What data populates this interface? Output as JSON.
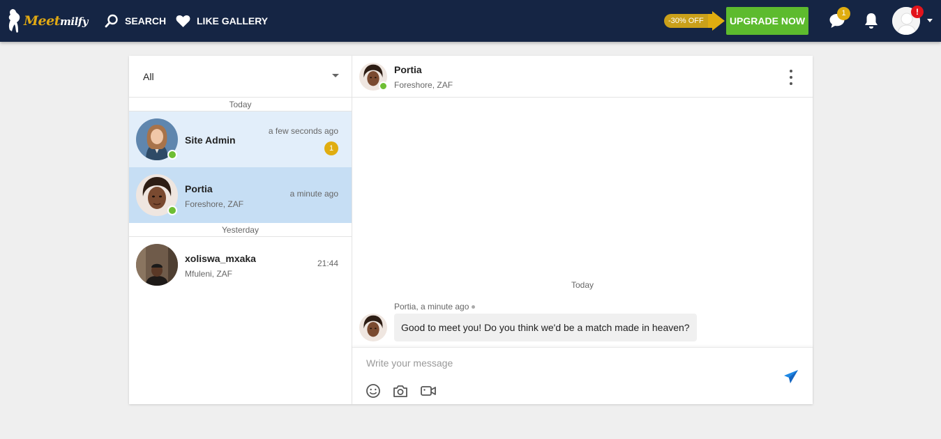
{
  "brand": {
    "logo_part1": "Meet",
    "logo_part2": "milfy"
  },
  "nav": {
    "search_label": "SEARCH",
    "like_gallery_label": "LIKE GALLERY",
    "discount_label": "-30% OFF",
    "upgrade_label": "UPGRADE NOW",
    "messages_badge": "1",
    "alert_badge": "!"
  },
  "colors": {
    "nav_bg": "#152544",
    "upgrade": "#5dbb2e",
    "badge": "#e0ad10",
    "online": "#6ebe33",
    "alert": "#e2141c",
    "active_row": "#c6def4",
    "send": "#1e88e5"
  },
  "sidebar": {
    "filter_value": "All",
    "groups": [
      {
        "label": "Today"
      },
      {
        "label": "Yesterday"
      }
    ],
    "conversations": [
      {
        "name": "Site Admin",
        "location": "",
        "time": "a few seconds ago",
        "unread": "1"
      },
      {
        "name": "Portia",
        "location": "Foreshore, ZAF",
        "time": "a minute ago"
      },
      {
        "name": "xoliswa_mxaka",
        "location": "Mfuleni, ZAF",
        "time": "21:44"
      }
    ]
  },
  "chat": {
    "header": {
      "name": "Portia",
      "location": "Foreshore, ZAF"
    },
    "day_label": "Today",
    "messages": [
      {
        "meta": "Portia, a minute ago",
        "text": "Good to meet you! Do you think we'd be a match made in heaven?"
      }
    ],
    "composer": {
      "placeholder": "Write your message",
      "value": ""
    }
  },
  "icons": [
    "search-icon",
    "heart-icon",
    "chat-bubble-icon",
    "bell-icon",
    "user-avatar",
    "chevron-down-icon",
    "more-vertical-icon",
    "emoji-icon",
    "camera-icon",
    "video-icon",
    "send-icon"
  ]
}
